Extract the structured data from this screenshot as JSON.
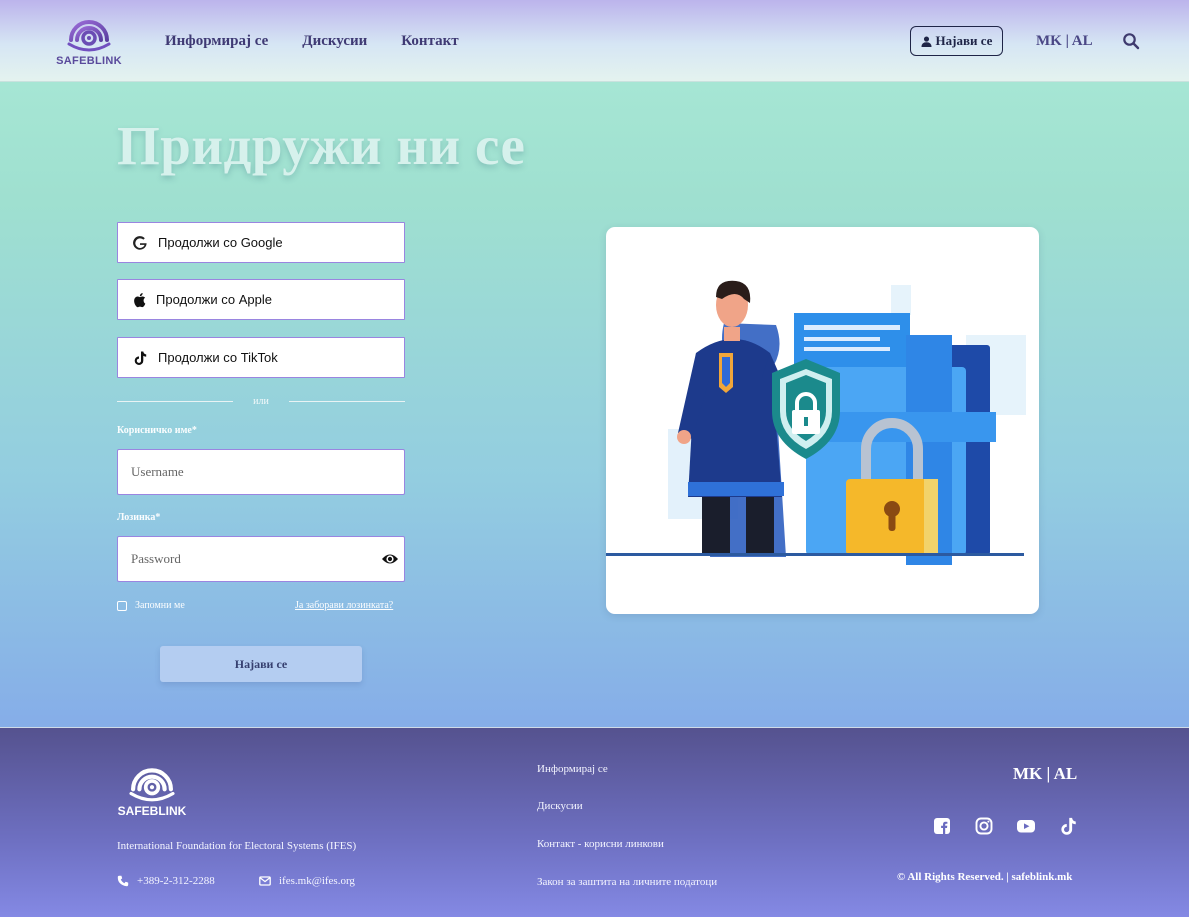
{
  "header": {
    "logo_text": "SAFEBLINK",
    "nav": [
      "Информирај се",
      "Дискусии",
      "Контакт"
    ],
    "login_label": "Најави се",
    "lang": "MK | AL"
  },
  "main": {
    "title": "Придружи ни се",
    "google_label": "Продолжи со Google",
    "apple_label": "Продолжи со Apple",
    "tiktok_label": "Продолжи со TikTok",
    "or_label": "или",
    "username_label": "Корисничко име*",
    "username_placeholder": "Username",
    "password_label": "Лозинка*",
    "password_placeholder": "Password",
    "remember_label": "Запомни ме",
    "forgot_label": "Ја заборави лозинката?",
    "submit_label": "Најави се"
  },
  "footer": {
    "logo_text": "SAFEBLINK",
    "org": "International Foundation for Electoral Systems (IFES)",
    "phone": "+389-2-312-2288",
    "email": "ifes.mk@ifes.org",
    "links": [
      "Информирај се",
      "Дискусии",
      "Контакт - корисни линкови",
      "Закон за заштита на личните податоци"
    ],
    "lang": "MK | AL",
    "copyright": "© All Rights Reserved. | safeblink.mk"
  },
  "colors": {
    "brand": "#5a4a9c",
    "input_border": "#9a85e0",
    "submit_bg": "#b4cdf1"
  }
}
